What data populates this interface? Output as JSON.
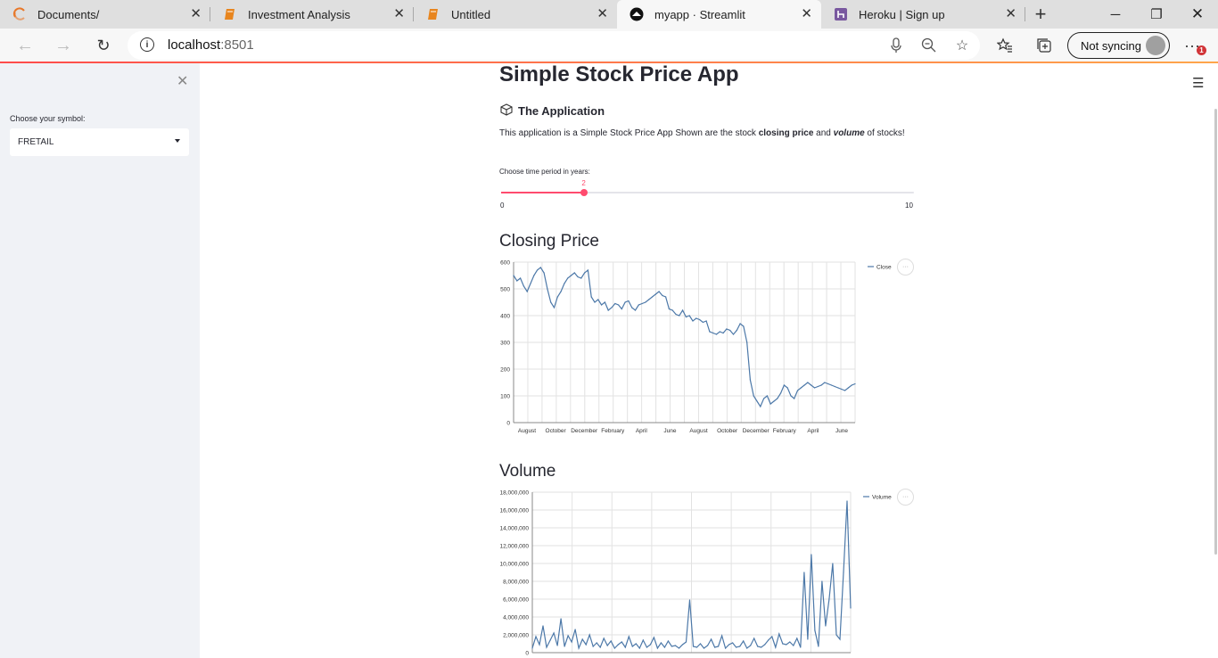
{
  "browser": {
    "tabs": [
      {
        "title": "Documents/",
        "icon": "spinner-icon"
      },
      {
        "title": "Investment Analysis",
        "icon": "notebook-icon"
      },
      {
        "title": "Untitled",
        "icon": "notebook-icon"
      },
      {
        "title": "myapp · Streamlit",
        "icon": "streamlit-icon"
      },
      {
        "title": "Heroku | Sign up",
        "icon": "heroku-icon"
      }
    ],
    "url_host": "localhost",
    "url_port": ":8501",
    "sync_label": "Not syncing",
    "notification_count": "1"
  },
  "sidebar": {
    "select_label": "Choose your symbol:",
    "select_value": "FRETAIL"
  },
  "main": {
    "title": "Simple Stock Price App",
    "subheader": "The Application",
    "desc_pre": "This application is a Simple Stock Price App Shown are the stock ",
    "desc_bold": "closing price",
    "desc_mid": " and ",
    "desc_bold_italic": "volume",
    "desc_post": " of stocks!",
    "slider": {
      "label": "Choose time period in years:",
      "value": 2,
      "min": 0,
      "max": 10
    }
  },
  "chart_data": [
    {
      "type": "line",
      "title": "Closing Price",
      "legend": "Close",
      "legend_position": "top-right",
      "grid": true,
      "ylim": [
        0,
        600
      ],
      "yticks": [
        "0",
        "100",
        "200",
        "300",
        "400",
        "500",
        "600"
      ],
      "xticks": [
        "August",
        "October",
        "December",
        "February",
        "April",
        "June",
        "August",
        "October",
        "December",
        "February",
        "April",
        "June"
      ],
      "x": [
        0,
        5,
        10,
        15,
        20,
        25,
        30,
        35,
        40,
        45,
        50,
        55,
        60,
        65,
        70,
        75,
        80,
        85,
        90,
        95,
        100,
        105,
        110,
        115,
        120,
        125,
        130,
        135,
        140,
        145,
        150,
        155,
        160,
        165,
        170,
        175,
        180,
        185,
        190,
        195,
        200,
        205,
        210,
        215,
        220,
        225,
        230,
        235,
        240,
        245,
        250,
        255,
        260,
        265,
        270,
        275,
        280,
        285,
        290,
        295,
        300,
        305,
        310,
        315,
        320,
        325,
        330,
        335,
        340,
        345,
        350,
        355,
        360,
        365,
        370,
        375,
        380,
        385,
        390,
        395,
        400,
        405,
        410,
        415,
        420,
        425,
        430,
        435,
        440,
        445,
        450,
        455,
        460,
        465,
        470,
        475,
        480,
        485,
        490,
        495,
        500,
        505
      ],
      "values": [
        550,
        530,
        540,
        510,
        490,
        520,
        550,
        570,
        580,
        560,
        500,
        450,
        430,
        470,
        490,
        520,
        540,
        550,
        560,
        545,
        540,
        560,
        570,
        470,
        450,
        460,
        440,
        450,
        420,
        430,
        445,
        440,
        425,
        450,
        455,
        430,
        420,
        440,
        445,
        450,
        460,
        470,
        480,
        490,
        475,
        470,
        425,
        420,
        405,
        400,
        420,
        395,
        400,
        380,
        390,
        385,
        375,
        380,
        340,
        335,
        330,
        340,
        335,
        350,
        345,
        330,
        345,
        370,
        360,
        300,
        160,
        100,
        80,
        60,
        90,
        100,
        70,
        80,
        90,
        110,
        140,
        130,
        100,
        90,
        120,
        130,
        140,
        150,
        140,
        130,
        135,
        140,
        150,
        145,
        140,
        135,
        130,
        125,
        120,
        130,
        140,
        145
      ]
    },
    {
      "type": "line",
      "title": "Volume",
      "legend": "Volume",
      "legend_position": "top-right",
      "grid": true,
      "ylim": [
        0,
        18000000
      ],
      "yticks": [
        "0",
        "2,000,000",
        "4,000,000",
        "6,000,000",
        "8,000,000",
        "10,000,000",
        "12,000,000",
        "14,000,000",
        "16,000,000",
        "18,000,000"
      ],
      "x": [
        0,
        4,
        8,
        12,
        16,
        20,
        24,
        28,
        32,
        36,
        40,
        44,
        48,
        52,
        56,
        60,
        64,
        68,
        72,
        76,
        80,
        84,
        88,
        92,
        96,
        100,
        104,
        108,
        112,
        116,
        120,
        124,
        128,
        132,
        136,
        140,
        144,
        148,
        152,
        156,
        160,
        164,
        168,
        172,
        176,
        180,
        184,
        188,
        192,
        196,
        200,
        204,
        208,
        212,
        216,
        220,
        224,
        228,
        232,
        236,
        240,
        244,
        248,
        252,
        256,
        260,
        264,
        268,
        272,
        276,
        280,
        284,
        288,
        292,
        296,
        300,
        304,
        308,
        312,
        316,
        320,
        324,
        328,
        332,
        336,
        340,
        344,
        348,
        352,
        356
      ],
      "values": [
        500000,
        1800000,
        900000,
        3000000,
        600000,
        1400000,
        2200000,
        800000,
        3800000,
        700000,
        1900000,
        1200000,
        2600000,
        500000,
        1500000,
        900000,
        2000000,
        700000,
        1100000,
        600000,
        1600000,
        800000,
        1300000,
        500000,
        900000,
        1200000,
        600000,
        1800000,
        700000,
        1000000,
        500000,
        1400000,
        600000,
        900000,
        1700000,
        500000,
        1100000,
        600000,
        1300000,
        700000,
        800000,
        500000,
        900000,
        1200000,
        5900000,
        700000,
        600000,
        1000000,
        500000,
        800000,
        1500000,
        600000,
        700000,
        1900000,
        500000,
        900000,
        1100000,
        600000,
        700000,
        1300000,
        500000,
        800000,
        1600000,
        700000,
        600000,
        900000,
        1400000,
        1800000,
        600000,
        2100000,
        1000000,
        900000,
        1200000,
        800000,
        1600000,
        600000,
        9000000,
        1500000,
        11000000,
        2500000,
        700000,
        8000000,
        3000000,
        6000000,
        10000000,
        2000000,
        1500000,
        9000000,
        17000000,
        5000000
      ]
    }
  ]
}
